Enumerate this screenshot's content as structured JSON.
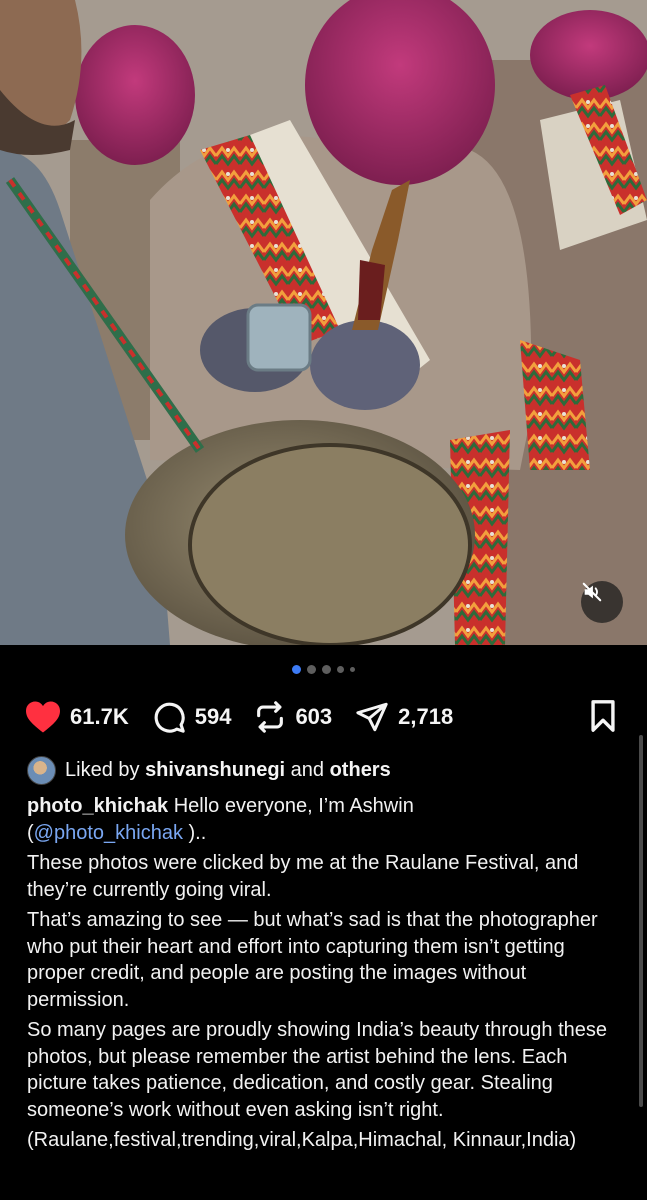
{
  "post": {
    "media": {
      "mute_icon": "speaker-muted-icon",
      "carousel": {
        "total_dots": 5,
        "active_index": 0
      }
    },
    "actions": {
      "likes": "61.7K",
      "comments": "594",
      "reposts": "603",
      "shares": "2,718",
      "like_color": "#ff3040"
    },
    "liked_by": {
      "user": "shivanshunegi",
      "connector": "and",
      "others": "others",
      "prefix": "Liked by"
    },
    "caption": {
      "username": "photo_khichak",
      "intro": "Hello everyone, I’m Ashwin",
      "open_paren": "(",
      "mention": "@photo_khichak",
      "close": " )..",
      "paragraphs": [
        "These photos were clicked by me at the Raulane Festival, and they’re currently going viral.",
        "That’s amazing to see — but what’s sad is that the photographer who put their heart and effort into capturing them isn’t getting proper credit, and people are posting the images without permission.",
        "So many pages are proudly showing India’s beauty through these photos, but please remember the artist behind the lens. Each picture takes patience, dedication, and costly gear. Stealing someone’s work without even asking isn’t right.",
        "(Raulane,festival,trending,viral,Kalpa,Himachal, Kinnaur,India)"
      ]
    },
    "colors": {
      "accent": "#3d7bf5",
      "mention": "#7aa7f2"
    }
  }
}
